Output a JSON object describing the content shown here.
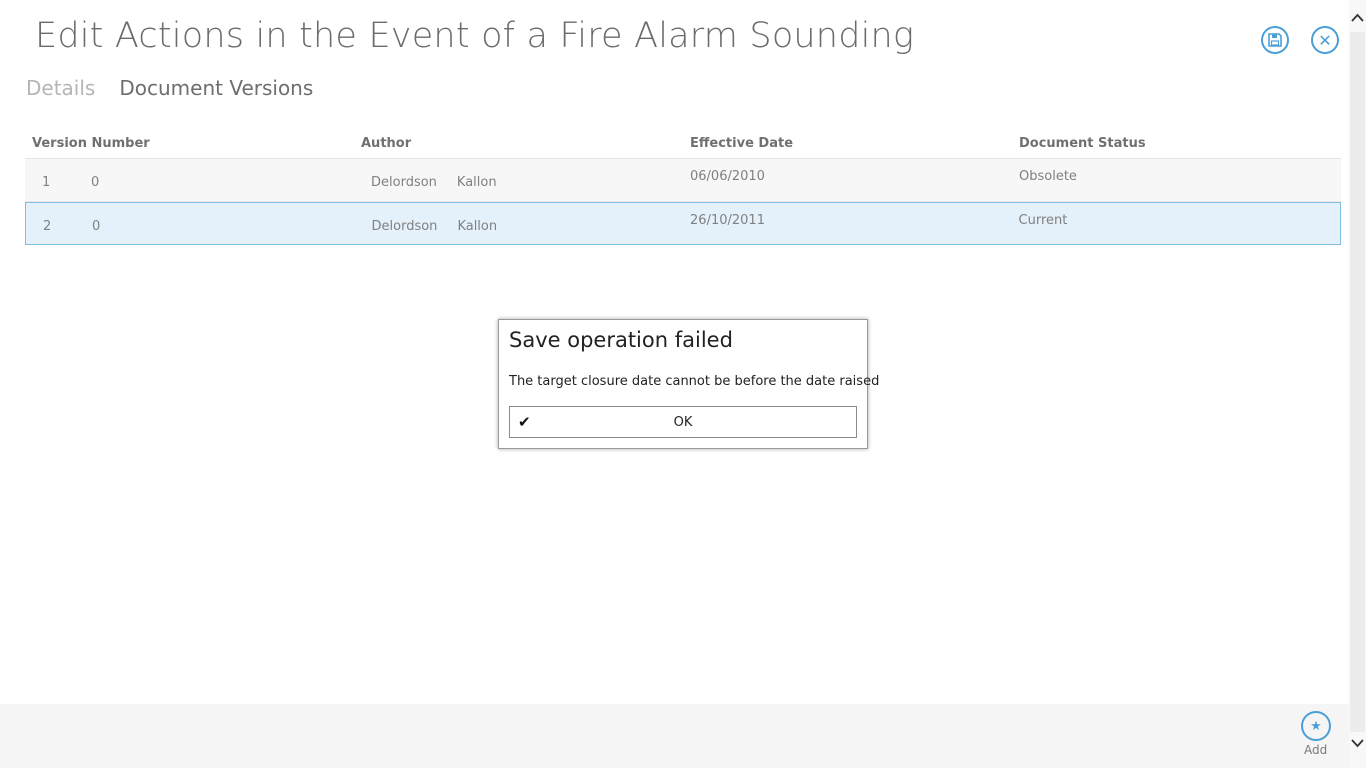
{
  "header": {
    "title": "Edit Actions in the Event of a Fire Alarm Sounding",
    "save_icon": "save-icon",
    "close_icon": "close-icon"
  },
  "tabs": [
    {
      "label": "Details",
      "active": false
    },
    {
      "label": "Document Versions",
      "active": true
    }
  ],
  "table": {
    "columns": [
      "Version Number",
      "Author",
      "Effective Date",
      "Document Status"
    ],
    "rows": [
      {
        "major": "1",
        "minor": "0",
        "first": "Delordson",
        "last": "Kallon",
        "date": "06/06/2010",
        "status": "Obsolete",
        "selected": false
      },
      {
        "major": "2",
        "minor": "0",
        "first": "Delordson",
        "last": "Kallon",
        "date": "26/10/2011",
        "status": "Current",
        "selected": true
      }
    ]
  },
  "dialog": {
    "title": "Save operation failed",
    "message": "The target closure date cannot be before the date raised",
    "ok_label": "OK",
    "ok_icon": "check-icon"
  },
  "footer": {
    "add_label": "Add",
    "add_icon": "star-icon"
  },
  "colors": {
    "accent": "#4a9fd8",
    "selected_row": "#e4f1fa"
  }
}
